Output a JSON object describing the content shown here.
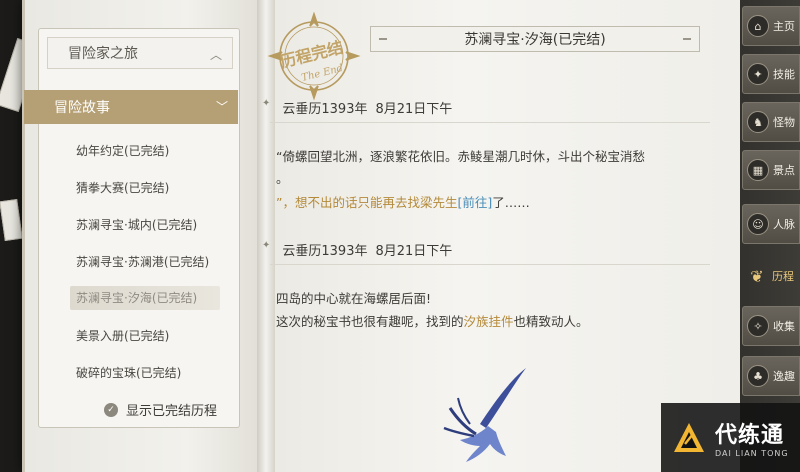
{
  "nav": {
    "group_label": "冒险家之旅",
    "section_label": "冒险故事",
    "stories": [
      {
        "label": "幼年约定(已完结)"
      },
      {
        "label": "猜拳大赛(已完结)"
      },
      {
        "label": "苏澜寻宝·城内(已完结)"
      },
      {
        "label": "苏澜寻宝·苏澜港(已完结)"
      },
      {
        "label": "苏澜寻宝·汐海(已完结)"
      },
      {
        "label": "美景入册(已完结)"
      },
      {
        "label": "破碎的宝珠(已完结)"
      }
    ],
    "active_index": 4,
    "toggle_label": "显示已完结历程"
  },
  "stamp": {
    "text_cn": "历程完结",
    "text_en": "The End"
  },
  "content": {
    "title": "苏澜寻宝·汐海(已完结)",
    "entries": [
      {
        "date": "云垂历1393年",
        "time": "8月21日下午",
        "line1_gold": "“倚螺回望北洲，逐浪繁花依旧。赤鲮星潮几时休，斗出个秘宝消愁",
        "line1b_gold": "。",
        "line2_prefix": "”，想不出的话只能再去找",
        "line2_npc": "梁先生",
        "line2_link": "[前往]",
        "line2_suffix": "了……"
      },
      {
        "date": "云垂历1393年",
        "time": "8月21日下午",
        "line1": "四岛的中心就在海螺居后面!",
        "line2_prefix": "这次的秘宝书也很有趣呢，找到的",
        "line2_item": "汐族挂件",
        "line2_suffix": "也精致动人。"
      }
    ]
  },
  "sidebar": {
    "items": [
      {
        "label": "主页",
        "icon": "home-icon",
        "glyph": "⌂"
      },
      {
        "label": "技能",
        "icon": "skill-icon",
        "glyph": "✦"
      },
      {
        "label": "怪物",
        "icon": "monster-icon",
        "glyph": "♞"
      },
      {
        "label": "景点",
        "icon": "scenic-icon",
        "glyph": "▦"
      },
      {
        "label": "人脉",
        "icon": "contacts-icon",
        "glyph": "☺"
      },
      {
        "label": "历程",
        "icon": "journey-icon",
        "glyph": "❦"
      },
      {
        "label": "收集",
        "icon": "collect-icon",
        "glyph": "✧"
      },
      {
        "label": "逸趣",
        "icon": "fun-icon",
        "glyph": "♣"
      }
    ],
    "active_index": 5
  },
  "watermark": {
    "cn": "代练通",
    "en": "DAI LIAN TONG"
  }
}
